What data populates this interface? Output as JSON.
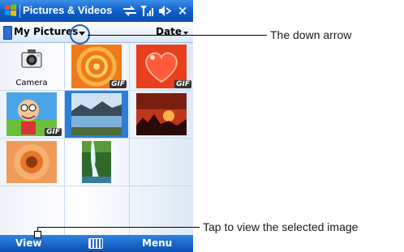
{
  "title_bar": {
    "title": "Pictures & Videos",
    "icons": [
      "windows-logo-icon",
      "connectivity-icon",
      "signal-icon",
      "volume-icon",
      "close-icon"
    ],
    "close_glyph": "×"
  },
  "folder_bar": {
    "folder": "My Pictures",
    "sort": "Date"
  },
  "grid": {
    "camera_label": "Camera",
    "gif_badge": "GIF"
  },
  "softkeys": {
    "left": "View",
    "right": "Menu"
  },
  "callouts": {
    "down_arrow": "The down arrow",
    "view": "Tap to view the selected image"
  },
  "colors": {
    "titlebar": "#0d5cc7",
    "selection": "#2c7fd6",
    "callout_circle": "#2558b8"
  }
}
